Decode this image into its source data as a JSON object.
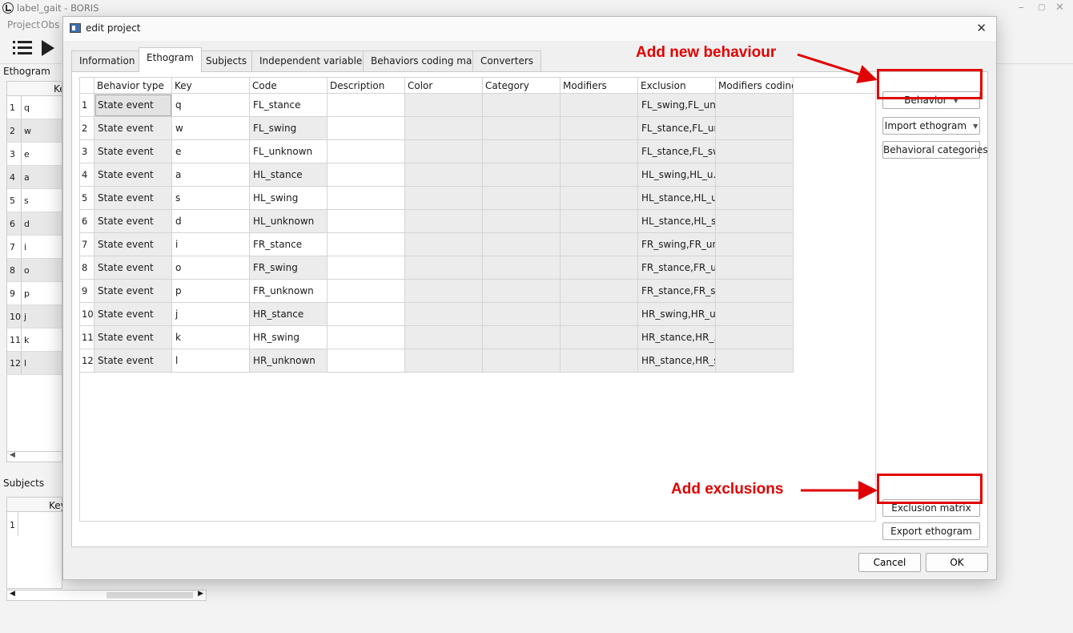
{
  "window": {
    "title": "label_gait - BORIS",
    "menu": [
      "Project",
      "Obs"
    ],
    "controls": {
      "minimize": "–",
      "maximize": "▢",
      "close": "✕"
    }
  },
  "left_panel": {
    "ethogram_label": "Ethogram",
    "ethogram_header": "Ke",
    "keys": [
      "q",
      "w",
      "e",
      "a",
      "s",
      "d",
      "i",
      "o",
      "p",
      "j",
      "k",
      "l"
    ],
    "scroll_arrow": "◀",
    "subjects_label": "Subjects",
    "subjects_header": "Key",
    "subjects_rows": [
      "1"
    ],
    "scroll_left": "◀",
    "scroll_right": "▶"
  },
  "dialog": {
    "title": "edit project",
    "close": "✕",
    "tabs": [
      "Information",
      "Ethogram",
      "Subjects",
      "Independent variables",
      "Behaviors coding map",
      "Converters"
    ],
    "active_tab": "Ethogram",
    "columns": [
      "Behavior type",
      "Key",
      "Code",
      "Description",
      "Color",
      "Category",
      "Modifiers",
      "Exclusion",
      "Modifiers coding r"
    ],
    "rows": [
      {
        "num": "1",
        "type": "State event",
        "key": "q",
        "code": "FL_stance",
        "exclusion": "FL_swing,FL_un..."
      },
      {
        "num": "2",
        "type": "State event",
        "key": "w",
        "code": "FL_swing",
        "exclusion": "FL_stance,FL_un..."
      },
      {
        "num": "3",
        "type": "State event",
        "key": "e",
        "code": "FL_unknown",
        "exclusion": "FL_stance,FL_sw..."
      },
      {
        "num": "4",
        "type": "State event",
        "key": "a",
        "code": "HL_stance",
        "exclusion": "HL_swing,HL_u..."
      },
      {
        "num": "5",
        "type": "State event",
        "key": "s",
        "code": "HL_swing",
        "exclusion": "HL_stance,HL_u..."
      },
      {
        "num": "6",
        "type": "State event",
        "key": "d",
        "code": "HL_unknown",
        "exclusion": "HL_stance,HL_s..."
      },
      {
        "num": "7",
        "type": "State event",
        "key": "i",
        "code": "FR_stance",
        "exclusion": "FR_swing,FR_un..."
      },
      {
        "num": "8",
        "type": "State event",
        "key": "o",
        "code": "FR_swing",
        "exclusion": "FR_stance,FR_u..."
      },
      {
        "num": "9",
        "type": "State event",
        "key": "p",
        "code": "FR_unknown",
        "exclusion": "FR_stance,FR_s..."
      },
      {
        "num": "10",
        "type": "State event",
        "key": "j",
        "code": "HR_stance",
        "exclusion": "HR_swing,HR_u..."
      },
      {
        "num": "11",
        "type": "State event",
        "key": "k",
        "code": "HR_swing",
        "exclusion": "HR_stance,HR_..."
      },
      {
        "num": "12",
        "type": "State event",
        "key": "l",
        "code": "HR_unknown",
        "exclusion": "HR_stance,HR_s..."
      }
    ],
    "buttons": {
      "behavior": "Behavior",
      "import_ethogram": "Import ethogram",
      "behavioral_categories": "Behavioral categories",
      "exclusion_matrix": "Exclusion matrix",
      "export_ethogram": "Export ethogram",
      "cancel": "Cancel",
      "ok": "OK",
      "dropdown_arrow": "▼"
    }
  },
  "annotations": {
    "add_behaviour": "Add new behaviour",
    "add_exclusions": "Add exclusions",
    "color": "#e10000"
  }
}
